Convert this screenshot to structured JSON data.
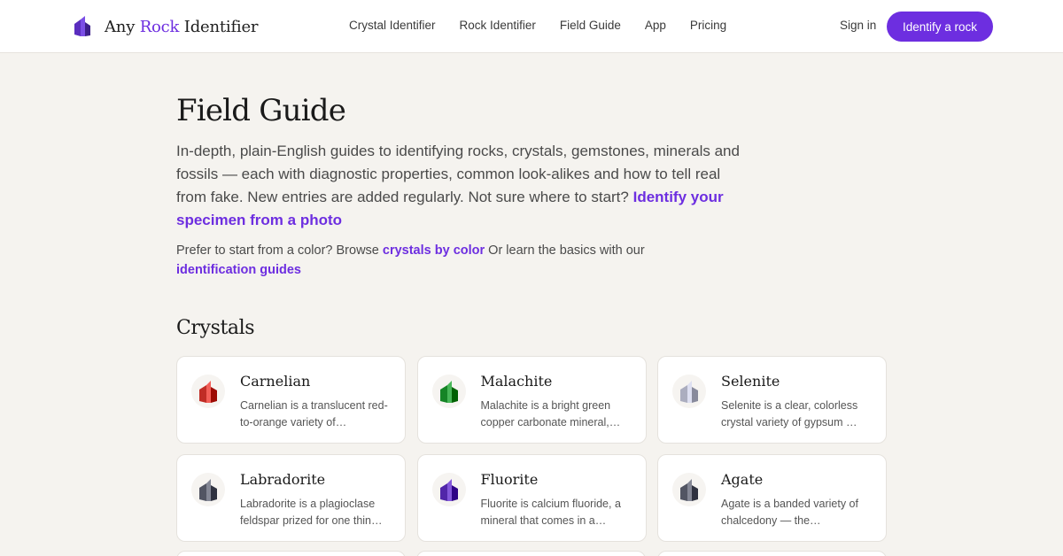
{
  "header": {
    "brand": {
      "part1": "Any ",
      "accent": "Rock",
      "part2": " Identifier"
    },
    "nav": [
      "Crystal Identifier",
      "Rock Identifier",
      "Field Guide",
      "App",
      "Pricing"
    ],
    "signin": "Sign in",
    "cta": "Identify a rock"
  },
  "main": {
    "title": "Field Guide",
    "intro_text": "In-depth, plain-English guides to identifying rocks, crystals, gemstones, minerals and fossils — each with diagnostic properties, common look-alikes and how to tell real from fake. New entries are added regularly. Not sure where to start? ",
    "intro_link": "Identify your specimen from a photo",
    "sub_text1": "Prefer to start from a color? Browse ",
    "sub_link1": "crystals by color",
    "sub_text2": " Or learn the basics with our ",
    "sub_link2": "identification guides",
    "section_title": "Crystals"
  },
  "cards": [
    {
      "name": "Carnelian",
      "desc": "Carnelian is a translucent red-to-orange variety of…",
      "icon": "crystal-icon",
      "color": "#d9463f"
    },
    {
      "name": "Malachite",
      "desc": "Malachite is a bright green copper carbonate mineral,…",
      "icon": "crystal-icon",
      "color": "#2e9d3f"
    },
    {
      "name": "Selenite",
      "desc": "Selenite is a clear, colorless crystal variety of gypsum …",
      "icon": "crystal-icon",
      "color": "#c4c6d8"
    },
    {
      "name": "Labradorite",
      "desc": "Labradorite is a plagioclase feldspar prized for one thin…",
      "icon": "crystal-icon",
      "color": "#6b6e7c"
    },
    {
      "name": "Fluorite",
      "desc": "Fluorite is calcium fluoride, a mineral that comes in a…",
      "icon": "crystal-icon",
      "color": "#6a3fc2"
    },
    {
      "name": "Agate",
      "desc": "Agate is a banded variety of chalcedony — the…",
      "icon": "crystal-icon",
      "color": "#6b6e7c"
    }
  ],
  "colors": {
    "accent": "#6d2ee0",
    "background": "#f5f3ef"
  }
}
